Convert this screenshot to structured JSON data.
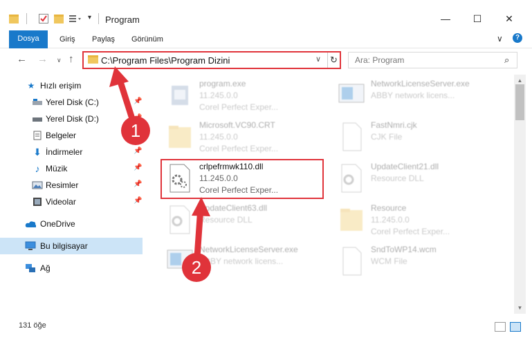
{
  "window": {
    "title": "Program",
    "minimize": "—",
    "maximize": "☐",
    "close": "✕"
  },
  "ribbon": {
    "tabs": [
      "Dosya",
      "Giriş",
      "Paylaş",
      "Görünüm"
    ],
    "expand": "∨",
    "help": "?"
  },
  "nav": {
    "back": "←",
    "forward": "→",
    "recent": "∨",
    "up": "↑",
    "address": "C:\\Program Files\\Program Dizini",
    "address_dropdown": "∨",
    "refresh": "↻",
    "search_placeholder": "Ara: Program",
    "search_icon": "⌕"
  },
  "sidebar": {
    "items": [
      {
        "label": "Hızlı erişim",
        "icon": "star-icon",
        "pinned": false
      },
      {
        "label": "Yerel Disk (C:)",
        "icon": "drive-icon",
        "pinned": true
      },
      {
        "label": "Yerel Disk (D:)",
        "icon": "drive-icon",
        "pinned": true
      },
      {
        "label": "Belgeler",
        "icon": "documents-icon",
        "pinned": true
      },
      {
        "label": "İndirmeler",
        "icon": "downloads-icon",
        "pinned": true
      },
      {
        "label": "Müzik",
        "icon": "music-icon",
        "pinned": true
      },
      {
        "label": "Resimler",
        "icon": "pictures-icon",
        "pinned": true
      },
      {
        "label": "Videolar",
        "icon": "videos-icon",
        "pinned": true
      },
      {
        "label": "OneDrive",
        "icon": "cloud-icon",
        "pinned": false
      },
      {
        "label": "Bu bilgisayar",
        "icon": "computer-icon",
        "pinned": false
      },
      {
        "label": "Ağ",
        "icon": "network-icon",
        "pinned": false
      }
    ]
  },
  "files": [
    {
      "name": "program.exe",
      "line2": "11.245.0.0",
      "line3": "Corel Perfect Exper...",
      "icon": "exe-icon"
    },
    {
      "name": "NetworkLicenseServer.exe",
      "line2": "ABBY network licens...",
      "line3": "",
      "icon": "exe-icon"
    },
    {
      "name": "Microsoft.VC90.CRT",
      "line2": "11.245.0.0",
      "line3": "Corel Perfect Exper...",
      "icon": "folder-icon"
    },
    {
      "name": "FastNmri.cjk",
      "line2": "CJK File",
      "line3": "",
      "icon": "file-icon"
    },
    {
      "name": "crlpefrmwk110.dll",
      "line2": "11.245.0.0",
      "line3": "Corel Perfect Exper...",
      "icon": "dll-gear-icon"
    },
    {
      "name": "UpdateClient21.dll",
      "line2": "Resource DLL",
      "line3": "",
      "icon": "dll-gear-icon"
    },
    {
      "name": "UpdateClient63.dll",
      "line2": "Resource DLL",
      "line3": "",
      "icon": "dll-gear-icon"
    },
    {
      "name": "Resource",
      "line2": "11.245.0.0",
      "line3": "Corel Perfect Exper...",
      "icon": "folder-icon"
    },
    {
      "name": "NetworkLicenseServer.exe",
      "line2": "ABBY network licens...",
      "line3": "",
      "icon": "exe-icon"
    },
    {
      "name": "SndToWP14.wcm",
      "line2": "WCM File",
      "line3": "",
      "icon": "file-icon"
    }
  ],
  "status": {
    "count": "131 öğe"
  },
  "annotations": {
    "badge1": "1",
    "badge2": "2"
  },
  "colors": {
    "accent": "#1979ca",
    "highlight": "#e0333a",
    "selected": "#cce4f7"
  }
}
